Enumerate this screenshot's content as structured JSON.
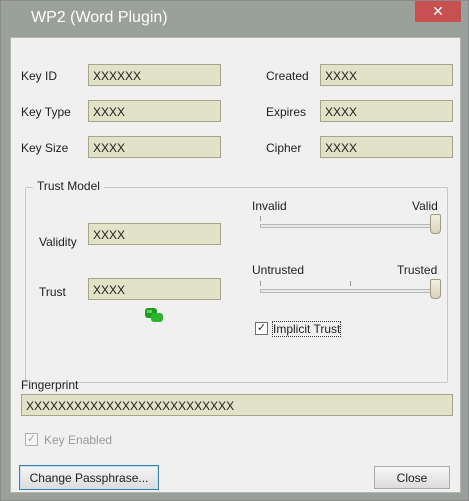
{
  "window": {
    "title": "WP2 (Word Plugin)",
    "close_glyph": "✕"
  },
  "key_info": {
    "key_id": {
      "label": "Key ID",
      "value": "XXXXXX"
    },
    "key_type": {
      "label": "Key Type",
      "value": "XXXX"
    },
    "key_size": {
      "label": "Key Size",
      "value": "XXXX"
    },
    "created": {
      "label": "Created",
      "value": "XXXX"
    },
    "expires": {
      "label": "Expires",
      "value": "XXXX"
    },
    "cipher": {
      "label": "Cipher",
      "value": "XXXX"
    }
  },
  "trust_model": {
    "title": "Trust Model",
    "validity": {
      "label": "Validity",
      "value": "XXXX"
    },
    "trust": {
      "label": "Trust",
      "value": "XXXX"
    },
    "validity_slider": {
      "min_label": "Invalid",
      "max_label": "Valid",
      "level": 1.0
    },
    "trust_slider": {
      "min_label": "Untrusted",
      "max_label": "Trusted",
      "level": 1.0
    },
    "implicit_trust": {
      "label": "Implicit Trust",
      "checked": true,
      "check_glyph": "✓"
    },
    "status_icon": "green-key-icon"
  },
  "fingerprint": {
    "label": "Fingerprint",
    "value": "XXXXXXXXXXXXXXXXXXXXXXXXXX"
  },
  "key_enabled": {
    "label": "Key Enabled",
    "checked": true,
    "disabled": true,
    "check_glyph": "✓"
  },
  "buttons": {
    "change_passphrase": "Change Passphrase...",
    "close": "Close"
  },
  "colors": {
    "title_bar": "#9aa09a",
    "close_button": "#c75050",
    "field_background": "#e2e2c8",
    "dialog_background": "#f0f0f0"
  }
}
